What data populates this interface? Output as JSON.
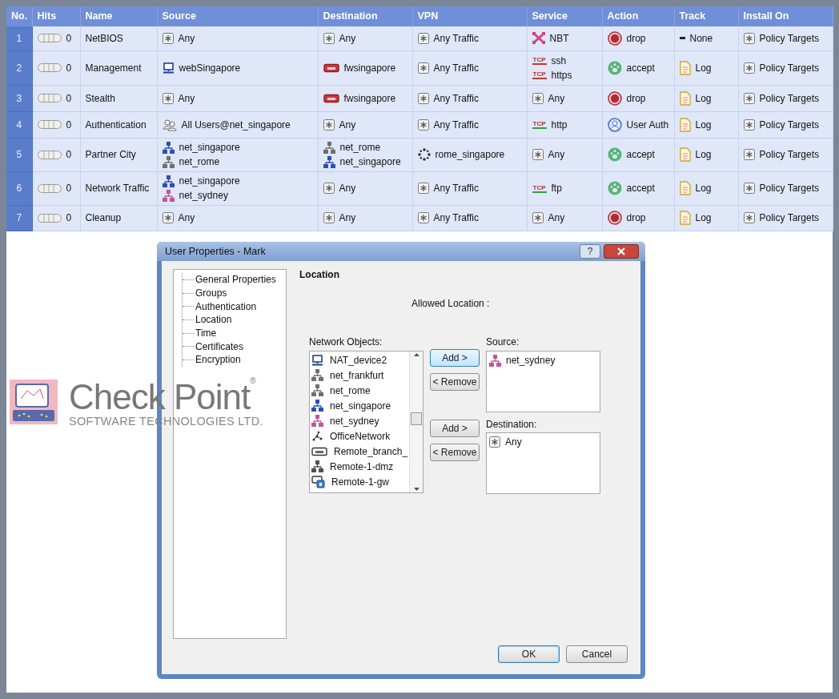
{
  "table": {
    "columns": [
      "No.",
      "Hits",
      "Name",
      "Source",
      "Destination",
      "VPN",
      "Service",
      "Action",
      "Track",
      "Install On"
    ],
    "rows": [
      {
        "no": "1",
        "hits": "0",
        "name": "NetBIOS",
        "source": [
          {
            "text": "Any",
            "kind": "any"
          }
        ],
        "destination": [
          {
            "text": "Any",
            "kind": "any"
          }
        ],
        "vpn": [
          {
            "text": "Any Traffic",
            "kind": "any"
          }
        ],
        "service": [
          {
            "text": "NBT",
            "kind": "netbios"
          }
        ],
        "action": {
          "text": "drop",
          "kind": "drop"
        },
        "track": {
          "text": "None",
          "kind": "none"
        },
        "install_on": [
          {
            "text": "Policy Targets",
            "kind": "any"
          }
        ]
      },
      {
        "no": "2",
        "hits": "0",
        "name": "Management",
        "source": [
          {
            "text": "webSingapore",
            "kind": "host"
          }
        ],
        "destination": [
          {
            "text": "fwsingapore",
            "kind": "gateway"
          }
        ],
        "vpn": [
          {
            "text": "Any Traffic",
            "kind": "any"
          }
        ],
        "service": [
          {
            "text": "ssh",
            "kind": "tcp",
            "protocol": "TCP",
            "color": "#c0392b"
          },
          {
            "text": "https",
            "kind": "tcp",
            "protocol": "TCP",
            "color": "#c0392b"
          }
        ],
        "action": {
          "text": "accept",
          "kind": "accept"
        },
        "track": {
          "text": "Log",
          "kind": "log"
        },
        "install_on": [
          {
            "text": "Policy Targets",
            "kind": "any"
          }
        ]
      },
      {
        "no": "3",
        "hits": "0",
        "name": "Stealth",
        "source": [
          {
            "text": "Any",
            "kind": "any"
          }
        ],
        "destination": [
          {
            "text": "fwsingapore",
            "kind": "gateway"
          }
        ],
        "vpn": [
          {
            "text": "Any Traffic",
            "kind": "any"
          }
        ],
        "service": [
          {
            "text": "Any",
            "kind": "any"
          }
        ],
        "action": {
          "text": "drop",
          "kind": "drop"
        },
        "track": {
          "text": "Log",
          "kind": "log"
        },
        "install_on": [
          {
            "text": "Policy Targets",
            "kind": "any"
          }
        ]
      },
      {
        "no": "4",
        "hits": "0",
        "name": "Authentication",
        "source": [
          {
            "text": "All Users@net_singapore",
            "kind": "users"
          }
        ],
        "destination": [
          {
            "text": "Any",
            "kind": "any"
          }
        ],
        "vpn": [
          {
            "text": "Any Traffic",
            "kind": "any"
          }
        ],
        "service": [
          {
            "text": "http",
            "kind": "tcp",
            "protocol": "TCP",
            "color": "#2e9e4f"
          }
        ],
        "action": {
          "text": "User Auth",
          "kind": "user_auth"
        },
        "track": {
          "text": "Log",
          "kind": "log"
        },
        "install_on": [
          {
            "text": "Policy Targets",
            "kind": "any"
          }
        ]
      },
      {
        "no": "5",
        "hits": "0",
        "name": "Partner City",
        "source": [
          {
            "text": "net_singapore",
            "kind": "network",
            "color": "#2e4fb0"
          },
          {
            "text": "net_rome",
            "kind": "network",
            "color": "#707070"
          }
        ],
        "destination": [
          {
            "text": "net_rome",
            "kind": "network",
            "color": "#707070"
          },
          {
            "text": "net_singapore",
            "kind": "network",
            "color": "#2e4fb0"
          }
        ],
        "vpn": [
          {
            "text": "rome_singapore",
            "kind": "community"
          }
        ],
        "service": [
          {
            "text": "Any",
            "kind": "any"
          }
        ],
        "action": {
          "text": "accept",
          "kind": "accept"
        },
        "track": {
          "text": "Log",
          "kind": "log"
        },
        "install_on": [
          {
            "text": "Policy Targets",
            "kind": "any"
          }
        ]
      },
      {
        "no": "6",
        "hits": "0",
        "name": "Network Traffic",
        "source": [
          {
            "text": "net_singapore",
            "kind": "network",
            "color": "#2e4fb0"
          },
          {
            "text": "net_sydney",
            "kind": "network",
            "color": "#c0569a"
          }
        ],
        "destination": [
          {
            "text": "Any",
            "kind": "any"
          }
        ],
        "vpn": [
          {
            "text": "Any Traffic",
            "kind": "any"
          }
        ],
        "service": [
          {
            "text": "ftp",
            "kind": "tcp",
            "protocol": "TCP",
            "color": "#2e9e4f"
          }
        ],
        "action": {
          "text": "accept",
          "kind": "accept"
        },
        "track": {
          "text": "Log",
          "kind": "log"
        },
        "install_on": [
          {
            "text": "Policy Targets",
            "kind": "any"
          }
        ]
      },
      {
        "no": "7",
        "hits": "0",
        "name": "Cleanup",
        "source": [
          {
            "text": "Any",
            "kind": "any"
          }
        ],
        "destination": [
          {
            "text": "Any",
            "kind": "any"
          }
        ],
        "vpn": [
          {
            "text": "Any Traffic",
            "kind": "any"
          }
        ],
        "service": [
          {
            "text": "Any",
            "kind": "any"
          }
        ],
        "action": {
          "text": "drop",
          "kind": "drop"
        },
        "track": {
          "text": "Log",
          "kind": "log"
        },
        "install_on": [
          {
            "text": "Policy Targets",
            "kind": "any"
          }
        ]
      }
    ]
  },
  "logo": {
    "name": "Check Point$^{®}$",
    "tagline": "SOFTWARE TECHNOLOGIES LTD."
  },
  "dialog": {
    "title": "User Properties - Mark",
    "help": "?",
    "tree": [
      "General Properties",
      "Groups",
      "Authentication",
      "Location",
      "Time",
      "Certificates",
      "Encryption"
    ],
    "section": "Location",
    "allowed_label": "Allowed Location :",
    "objects_label": "Network Objects:",
    "objects": [
      {
        "text": "NAT_device2",
        "kind": "host"
      },
      {
        "text": "net_frankfurt",
        "kind": "network",
        "color": "#707070"
      },
      {
        "text": "net_rome",
        "kind": "network",
        "color": "#707070"
      },
      {
        "text": "net_singapore",
        "kind": "network",
        "color": "#2e4fb0"
      },
      {
        "text": "net_sydney",
        "kind": "network",
        "color": "#c0569a"
      },
      {
        "text": "OfficeNetwork",
        "kind": "dots"
      },
      {
        "text": "Remote_branch_",
        "kind": "device"
      },
      {
        "text": "Remote-1-dmz",
        "kind": "network",
        "color": "#505050"
      },
      {
        "text": "Remote-1-gw",
        "kind": "cluster"
      }
    ],
    "source_label": "Source:",
    "source": [
      {
        "text": "net_sydney",
        "kind": "network",
        "color": "#c0569a"
      }
    ],
    "destination_label": "Destination:",
    "destination": [
      {
        "text": "Any",
        "kind": "any"
      }
    ],
    "add_buttons": [
      "Add >",
      "Add >"
    ],
    "remove_buttons": [
      "< Remove",
      "< Remove"
    ],
    "ok": "OK",
    "cancel": "Cancel"
  }
}
